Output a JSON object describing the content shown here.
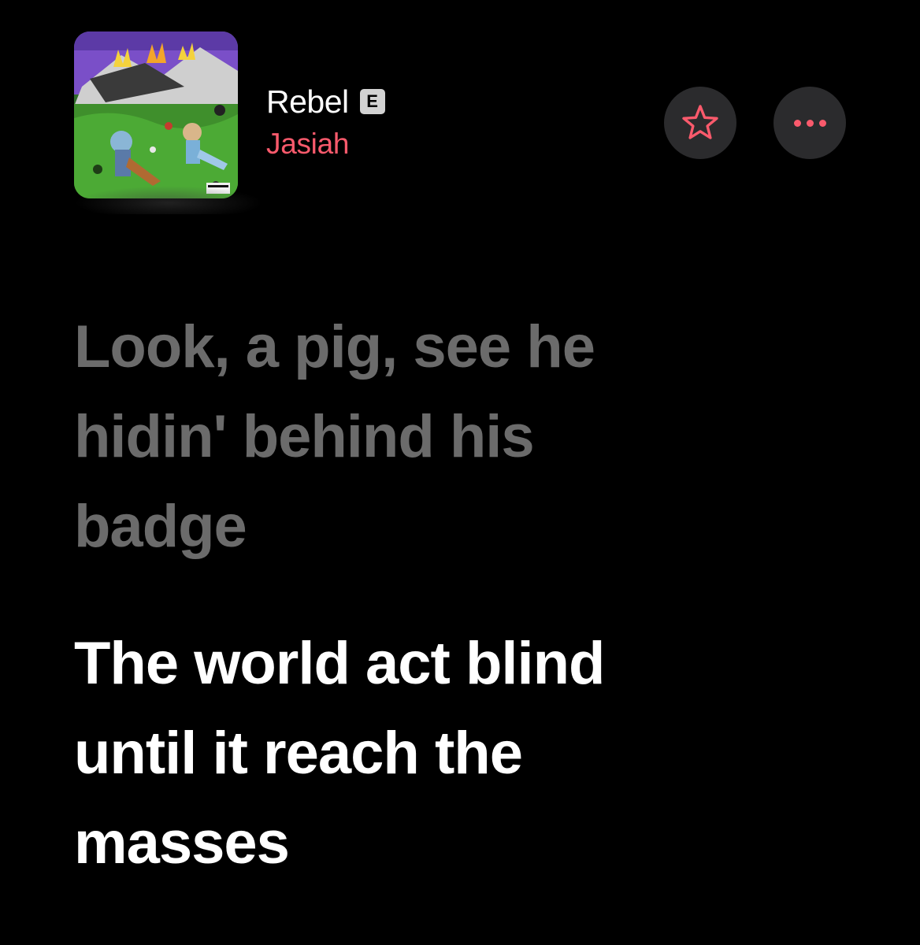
{
  "track": {
    "title": "Rebel",
    "explicit_badge": "E",
    "artist": "Jasiah",
    "artwork_icon": "album-artwork"
  },
  "actions": {
    "favorite_icon": "star-icon",
    "more_icon": "ellipsis-icon"
  },
  "lyrics": {
    "previous": [
      "Look, a pig, see he",
      "hidin' behind his",
      "badge"
    ],
    "current": [
      "The world act blind",
      "until it reach the",
      "masses"
    ]
  },
  "colors": {
    "background": "#000000",
    "accent": "#fa5a6c",
    "button_bg": "#2b2b2d",
    "lyric_dim": "#6b6b6b",
    "lyric_active": "#ffffff"
  }
}
